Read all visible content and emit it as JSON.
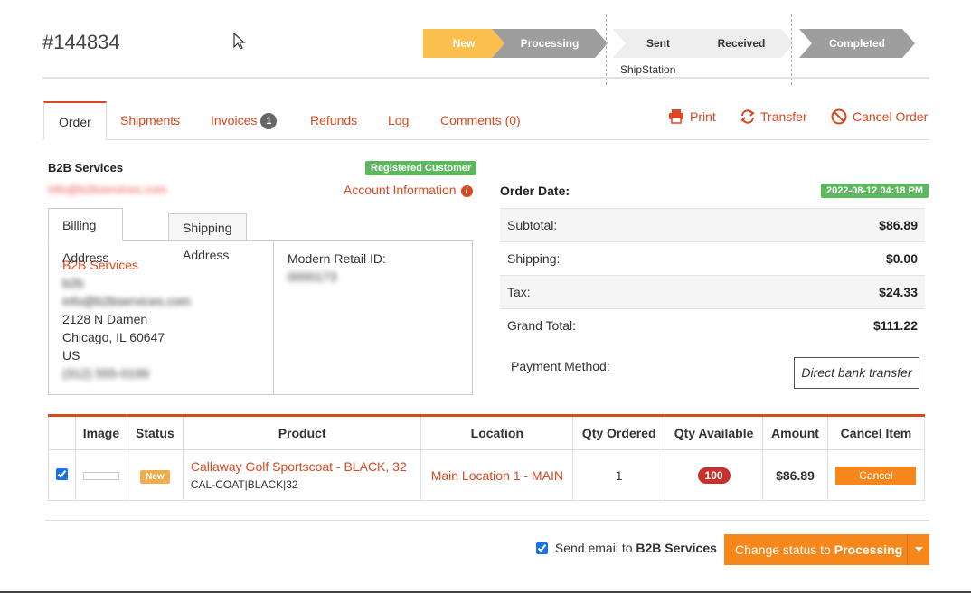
{
  "order": {
    "number": "#144834"
  },
  "steps": [
    {
      "label": "New",
      "color": "#fbc04e"
    },
    {
      "label": "Processing",
      "color": "#9e9e9e"
    },
    {
      "label": "Sent",
      "color": "#eeeeee",
      "text_color": "#333333"
    },
    {
      "label": "Received",
      "color": "#eeeeee",
      "text_color": "#333333"
    },
    {
      "label": "Completed",
      "color": "#9e9e9e"
    }
  ],
  "shipstation_label": "ShipStation",
  "tabs": {
    "order": "Order",
    "shipments": "Shipments",
    "invoices": "Invoices",
    "invoices_count": "1",
    "refunds": "Refunds",
    "log": "Log",
    "comments": "Comments (0)"
  },
  "actions": {
    "print": "Print",
    "transfer": "Transfer",
    "cancel_order": "Cancel Order"
  },
  "customer": {
    "name": "B2B Services",
    "badge": "Registered Customer",
    "email": "info@b2bservices.com",
    "account_info": "Account Information"
  },
  "address_tabs": {
    "billing": "Billing Address",
    "shipping": "Shipping Address"
  },
  "address": {
    "company": "B2B Services",
    "line_redacted": "b2b",
    "email_redacted": "info@b2bservices.com",
    "street": "2128 N Damen",
    "city": "Chicago, IL 60647",
    "country": "US",
    "phone_redacted": "(312) 555-0199"
  },
  "retail": {
    "label": "Modern Retail ID:",
    "value_redacted": "0000173"
  },
  "order_date": {
    "label": "Order Date:",
    "value": "2022-08-12 04:18 PM"
  },
  "totals": [
    {
      "label": "Subtotal:",
      "value": "$86.89"
    },
    {
      "label": "Shipping:",
      "value": "$0.00"
    },
    {
      "label": "Tax:",
      "value": "$24.33"
    },
    {
      "label": "Grand Total:",
      "value": "$111.22"
    }
  ],
  "payment": {
    "label": "Payment Method:",
    "value": "Direct bank transfer"
  },
  "table": {
    "headers": [
      "",
      "Image",
      "Status",
      "Product",
      "Location",
      "Qty Ordered",
      "Qty Available",
      "Amount",
      "Cancel Item"
    ],
    "rows": [
      {
        "checked": true,
        "status": "New",
        "product_name": "Callaway Golf Sportscoat - BLACK, 32",
        "sku": "CAL-COAT|BLACK|32",
        "location": "Main Location 1 - MAIN",
        "qty_ordered": "1",
        "qty_available": "100",
        "amount": "$86.89",
        "cancel_label": "Cancel"
      }
    ]
  },
  "footer": {
    "send_email_prefix": "Send email to",
    "send_email_name": "B2B Services",
    "status_prefix": "Change status to",
    "status_target": "Processing"
  },
  "colors": {
    "accent": "#d9481f",
    "button": "#f7861b",
    "success": "#5cb85c"
  }
}
